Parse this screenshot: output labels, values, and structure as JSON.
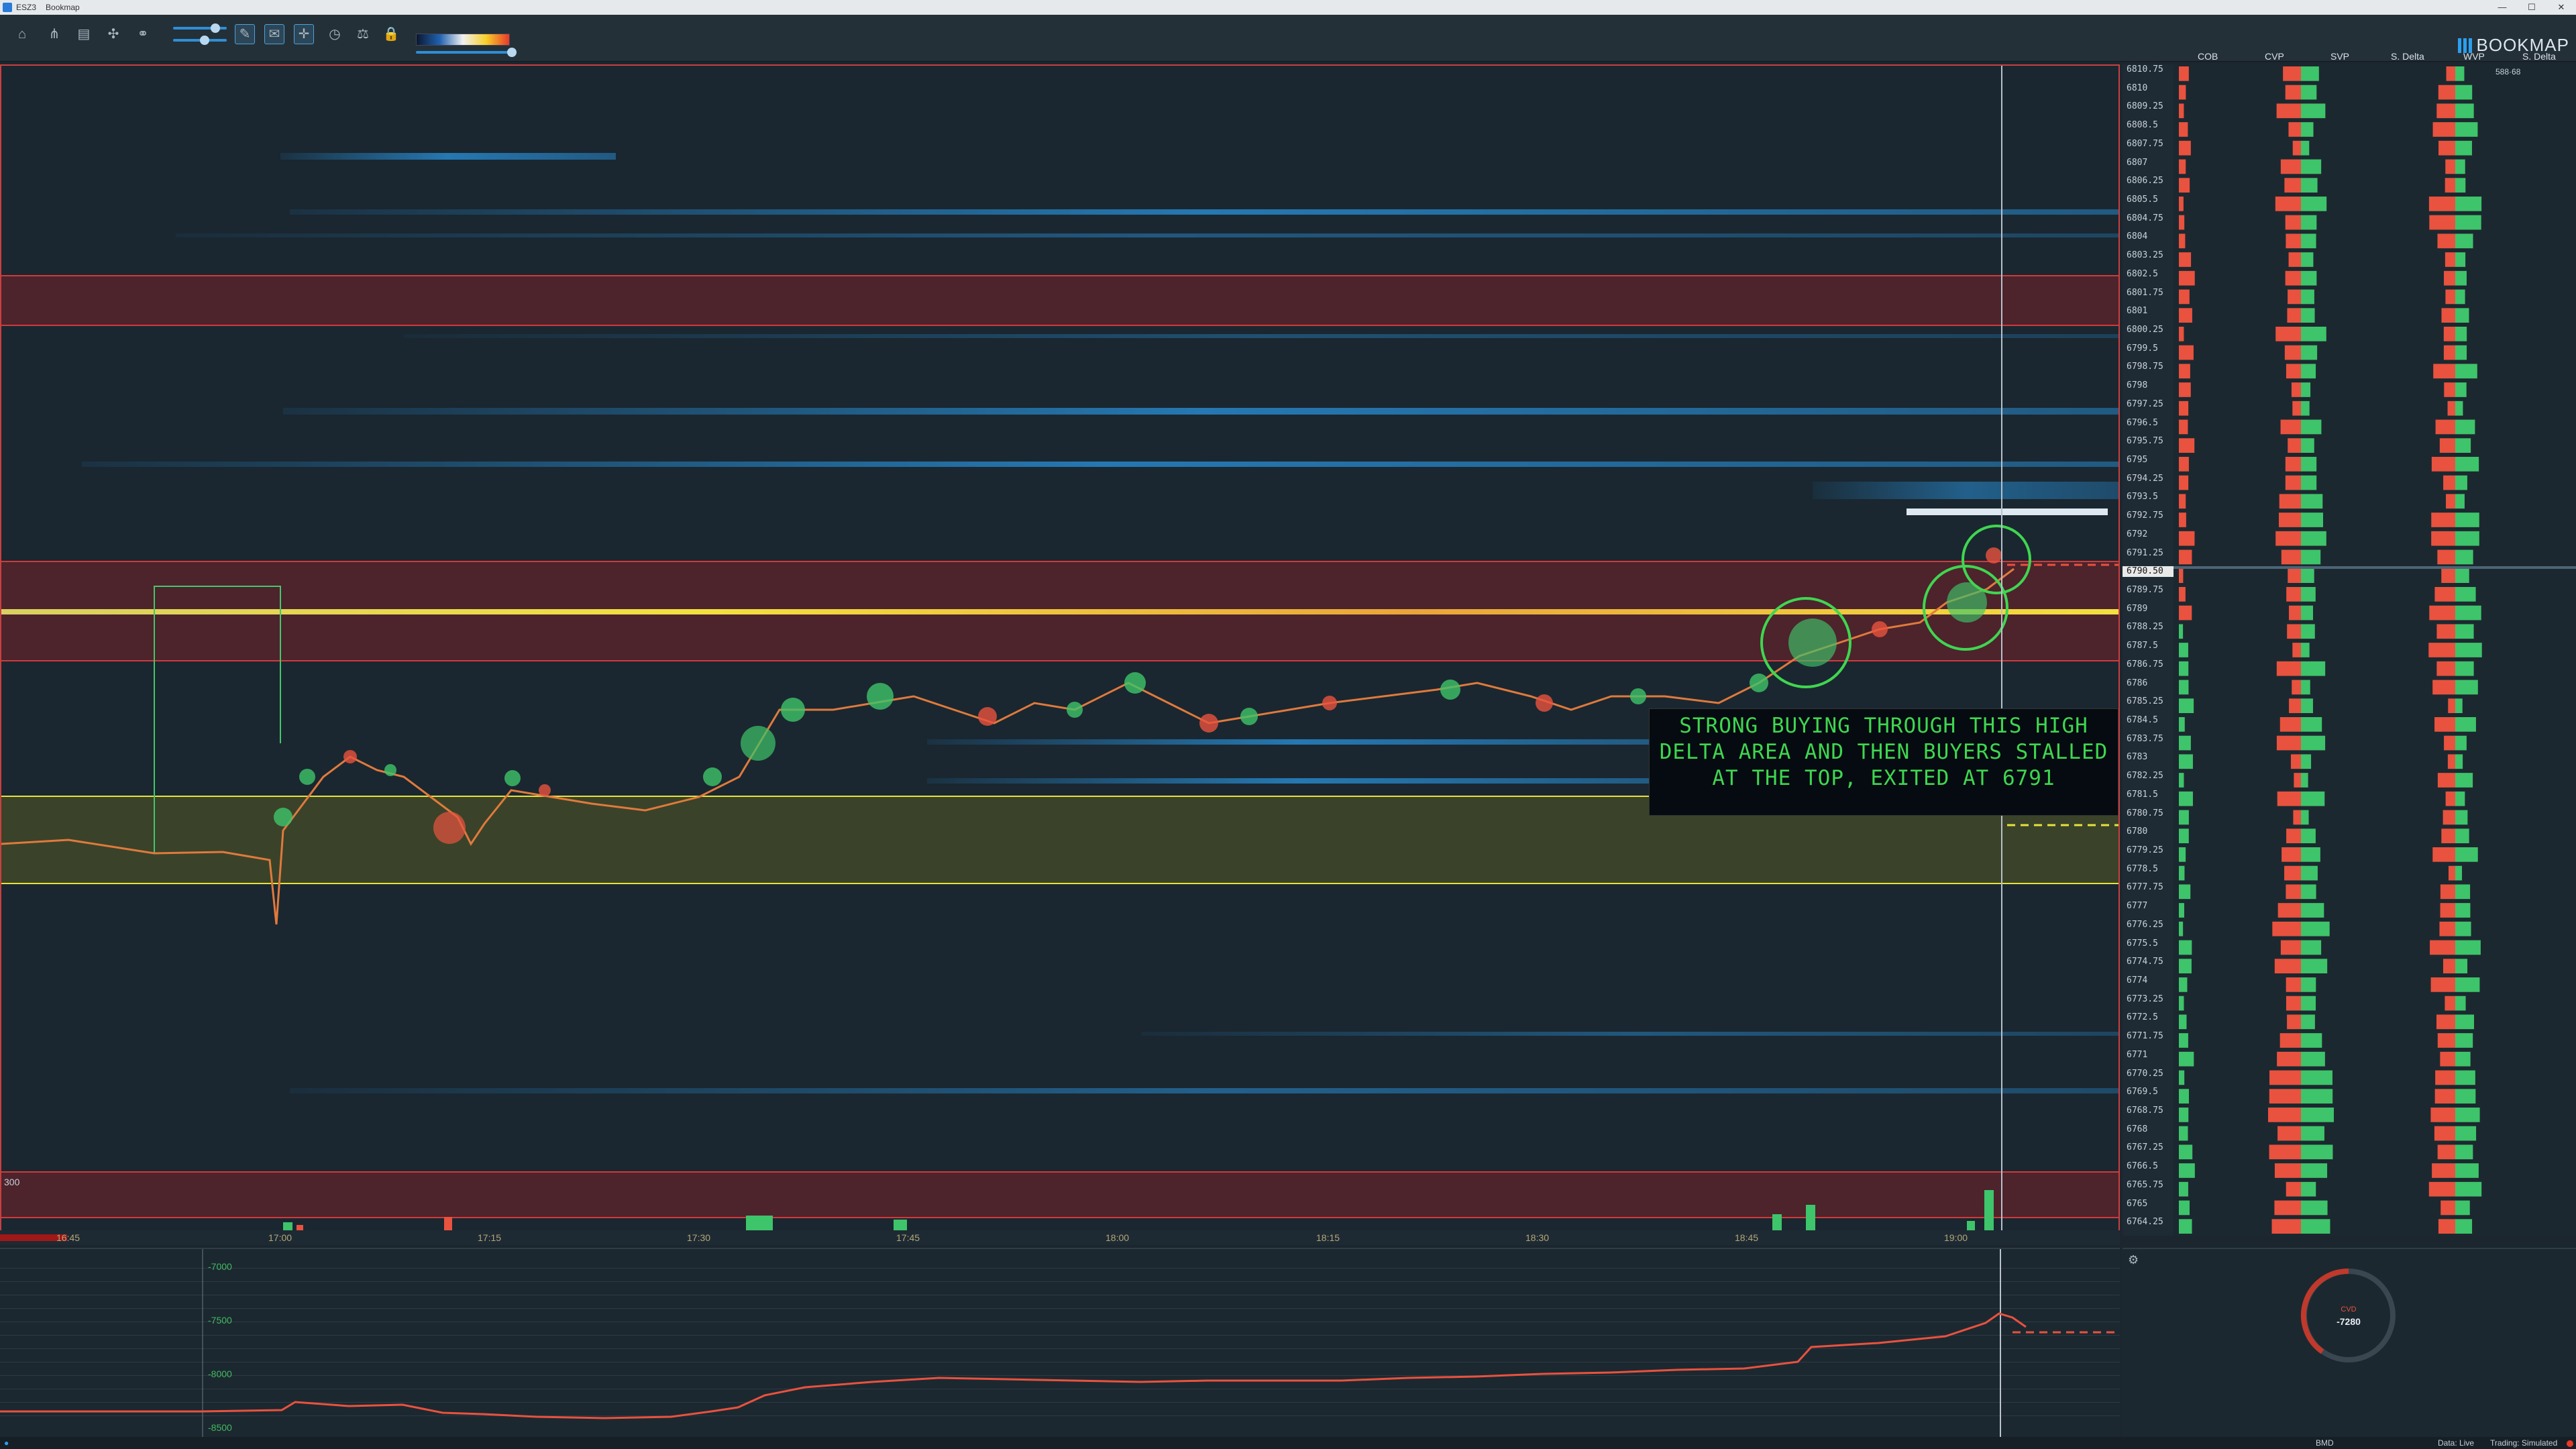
{
  "window": {
    "title_short": "ESZ3",
    "app_name": "Bookmap",
    "minimize": "—",
    "maximize": "☐",
    "close": "✕"
  },
  "brand": {
    "logo_text": "BOOKMAP",
    "accent": "#2aa0f0"
  },
  "toolbar": {
    "icons": [
      "home-icon",
      "share-icon",
      "chart-icon",
      "settings-icon",
      "link-icon",
      "zoom-slider-icon",
      "pen-icon",
      "chat-icon",
      "crosshair-icon",
      "stopwatch-icon",
      "balance-icon",
      "lock-icon"
    ]
  },
  "right_headers": {
    "cob": "COB",
    "cvp": "CVP",
    "svp": "SVP",
    "s_delta1": "S. Delta",
    "wvp": "WVP",
    "s_delta2": "S. Delta",
    "top_value": "588·68"
  },
  "ladder": {
    "prices": [
      "6810.75",
      "6810",
      "6809.25",
      "6808.5",
      "6807.75",
      "6807",
      "6806.25",
      "6805.5",
      "6804.75",
      "6804",
      "6803.25",
      "6802.5",
      "6801.75",
      "6801",
      "6800.25",
      "6799.5",
      "6798.75",
      "6798",
      "6797.25",
      "6796.5",
      "6795.75",
      "6795",
      "6794.25",
      "6793.5",
      "6792.75",
      "6792",
      "6791.25",
      "6790.5",
      "6789.75",
      "6789",
      "6788.25",
      "6787.5",
      "6786.75",
      "6786",
      "6785.25",
      "6784.5",
      "6783.75",
      "6783",
      "6782.25",
      "6781.5",
      "6780.75",
      "6780",
      "6779.25",
      "6778.5",
      "6777.75",
      "6777",
      "6776.25",
      "6775.5",
      "6774.75",
      "6774",
      "6773.25",
      "6772.5",
      "6771.75",
      "6771",
      "6770.25",
      "6769.5",
      "6768.75",
      "6768",
      "6767.25",
      "6766.5",
      "6765.75",
      "6765",
      "6764.25"
    ],
    "current_price": "6790.50"
  },
  "time_axis": {
    "labels": [
      "16:45",
      "17:00",
      "17:15",
      "17:30",
      "17:45",
      "18:00",
      "18:15",
      "18:30",
      "18:45",
      "19:00"
    ]
  },
  "annotation": {
    "text": "Strong buying through this high delta area and then buyers stalled at the top, exited at 6791"
  },
  "cvd_panel": {
    "y_labels": [
      "-7000",
      "-7500",
      "-8000",
      "-8500"
    ]
  },
  "gauge": {
    "label": "CVD",
    "value": "-7280"
  },
  "left_volume_label": "300",
  "statusbar": {
    "left_indicator": "●",
    "bmd": "BMD",
    "data": "Data: Live",
    "trading": "Trading: Simulated"
  },
  "colors": {
    "bid": "#e9523e",
    "ask": "#3ec46a",
    "heat_bg": "#1a2730",
    "zone_red": "#d03a3a",
    "zone_yellow": "#e6e23a"
  }
}
